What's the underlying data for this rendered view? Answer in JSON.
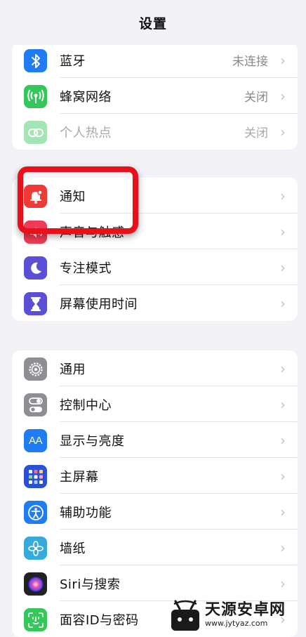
{
  "header": {
    "title": "设置"
  },
  "group1": [
    {
      "label": "蓝牙",
      "value": "未连接",
      "icon": "bluetooth-icon",
      "color": "#1f7cf3"
    },
    {
      "label": "蜂窝网络",
      "value": "关闭",
      "icon": "cellular-icon",
      "color": "#34c759"
    },
    {
      "label": "个人热点",
      "value": "关闭",
      "icon": "hotspot-icon",
      "color": "#34c759",
      "disabled": true
    }
  ],
  "group2": [
    {
      "label": "通知",
      "icon": "notification-icon",
      "color": "#ef3b36"
    },
    {
      "label": "声音与触感",
      "icon": "sound-icon",
      "color": "#ef3b55"
    },
    {
      "label": "专注模式",
      "icon": "moon-icon",
      "color": "#5b4fd6"
    },
    {
      "label": "屏幕使用时间",
      "icon": "hourglass-icon",
      "color": "#5b4fd6"
    }
  ],
  "group3": [
    {
      "label": "通用",
      "icon": "gear-icon",
      "color": "#8e8e93"
    },
    {
      "label": "控制中心",
      "icon": "toggles-icon",
      "color": "#8e8e93"
    },
    {
      "label": "显示与亮度",
      "icon": "text-size-icon",
      "color": "#1f7cf3"
    },
    {
      "label": "主屏幕",
      "icon": "home-grid-icon",
      "color": "#2b50d8"
    },
    {
      "label": "辅助功能",
      "icon": "accessibility-icon",
      "color": "#1f7cf3"
    },
    {
      "label": "墙纸",
      "icon": "flower-icon",
      "color": "#36aadc"
    },
    {
      "label": "Siri与搜索",
      "icon": "siri-icon",
      "color": "#222222"
    },
    {
      "label": "面容ID与密码",
      "icon": "face-id-icon",
      "color": "#34c759"
    }
  ],
  "watermark": {
    "name": "天源安卓网",
    "url": "www.jytyaz.com"
  }
}
